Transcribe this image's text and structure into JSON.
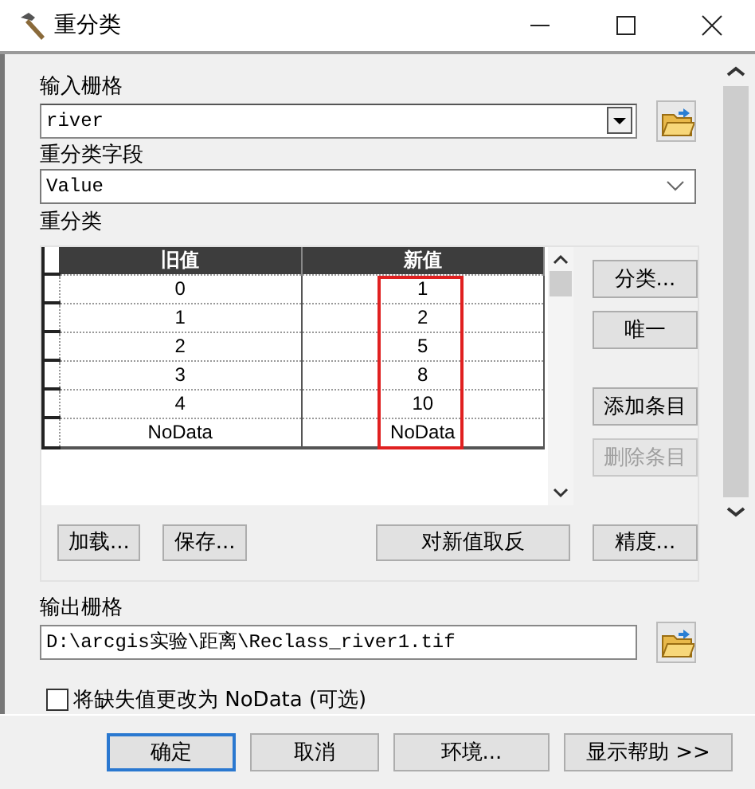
{
  "window": {
    "title": "重分类"
  },
  "input_raster": {
    "label": "输入栅格",
    "value": "river"
  },
  "reclass_field": {
    "label": "重分类字段",
    "value": "Value"
  },
  "reclassification": {
    "label": "重分类",
    "table": {
      "columns": [
        {
          "label": "旧值",
          "highlighted": false
        },
        {
          "label": "新值",
          "highlighted": true
        }
      ],
      "rows": [
        [
          "0",
          "1"
        ],
        [
          "1",
          "2"
        ],
        [
          "2",
          "5"
        ],
        [
          "3",
          "8"
        ],
        [
          "4",
          "10"
        ],
        [
          "NoData",
          "NoData"
        ]
      ]
    },
    "side_buttons": [
      {
        "label": "分类...",
        "disabled": false
      },
      {
        "label": "唯一",
        "disabled": false
      },
      {
        "label": "添加条目",
        "disabled": false
      },
      {
        "label": "删除条目",
        "disabled": true
      }
    ],
    "bottom_buttons": [
      {
        "label": "加载..."
      },
      {
        "label": "保存..."
      },
      {
        "label": "对新值取反"
      },
      {
        "label": "精度..."
      }
    ]
  },
  "output_raster": {
    "label": "输出栅格",
    "value": "D:\\arcgis实验\\距离\\Reclass_river1.tif"
  },
  "nodata_option": {
    "label": "将缺失值更改为 NoData (可选)",
    "checked": false
  },
  "buttons": [
    {
      "label": "确定",
      "default": true
    },
    {
      "label": "取消",
      "default": false
    },
    {
      "label": "环境...",
      "default": false
    },
    {
      "label": "显示帮助 >>",
      "default": false
    }
  ]
}
